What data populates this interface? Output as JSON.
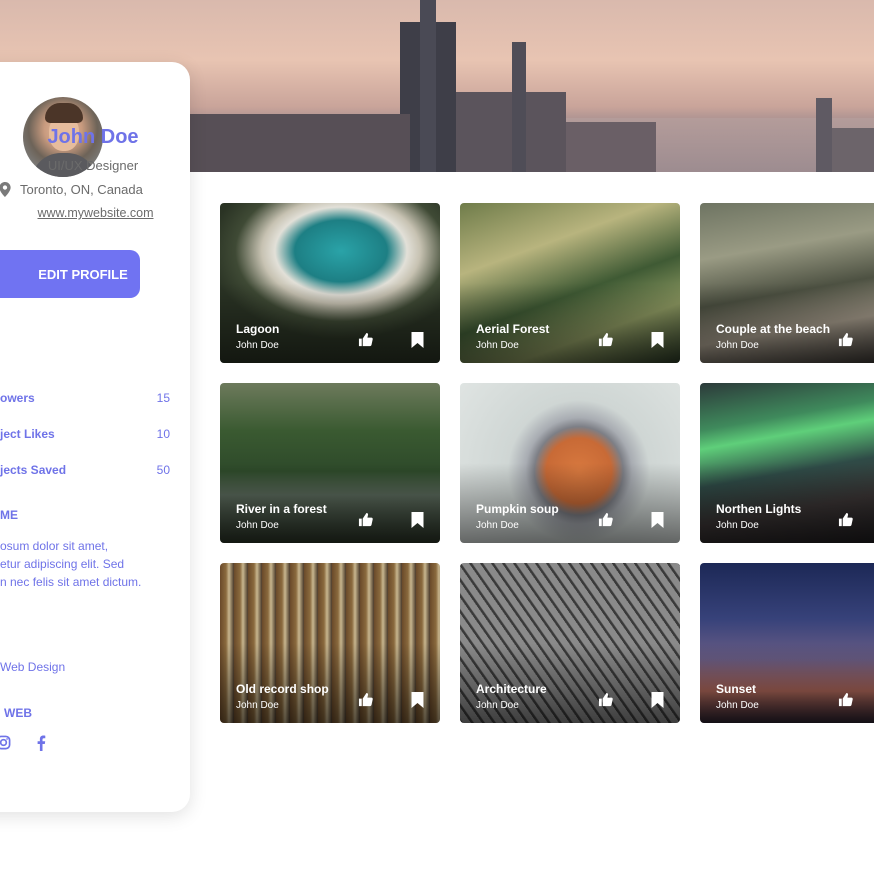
{
  "profile": {
    "name": "John Doe",
    "role": "UI/UX Designer",
    "location": "Toronto, ON, Canada",
    "website": "www.mywebsite.com",
    "edit_button": "EDIT PROFILE"
  },
  "stats": [
    {
      "label": "Followers",
      "visible_label": "owers",
      "value": "15"
    },
    {
      "label": "Project Likes",
      "visible_label": "ject Likes",
      "value": "10"
    },
    {
      "label": "Projects Saved",
      "visible_label": "jects Saved",
      "value": "50"
    }
  ],
  "about": {
    "title": "ME",
    "lines": [
      "osum dolor sit amet,",
      "etur adipiscing elit. Sed",
      "n nec felis sit amet dictum."
    ]
  },
  "skills": {
    "item": "Web Design"
  },
  "web": {
    "title": "WEB",
    "icons": [
      "instagram-icon",
      "facebook-icon"
    ]
  },
  "colors": {
    "accent": "#7073f2",
    "text_muted": "#6b6b6b"
  },
  "gallery": [
    {
      "title": "Lagoon",
      "author": "John Doe",
      "save": true
    },
    {
      "title": "Aerial Forest",
      "author": "John Doe",
      "save": true
    },
    {
      "title": "Couple at the beach",
      "author": "John Doe",
      "save": false
    },
    {
      "title": "River in a forest",
      "author": "John Doe",
      "save": true
    },
    {
      "title": "Pumpkin soup",
      "author": "John Doe",
      "save": true
    },
    {
      "title": "Northen Lights",
      "author": "John Doe",
      "save": false
    },
    {
      "title": "Old record shop",
      "author": "John Doe",
      "save": true
    },
    {
      "title": "Architecture",
      "author": "John Doe",
      "save": true
    },
    {
      "title": "Sunset",
      "author": "John Doe",
      "save": false
    }
  ]
}
